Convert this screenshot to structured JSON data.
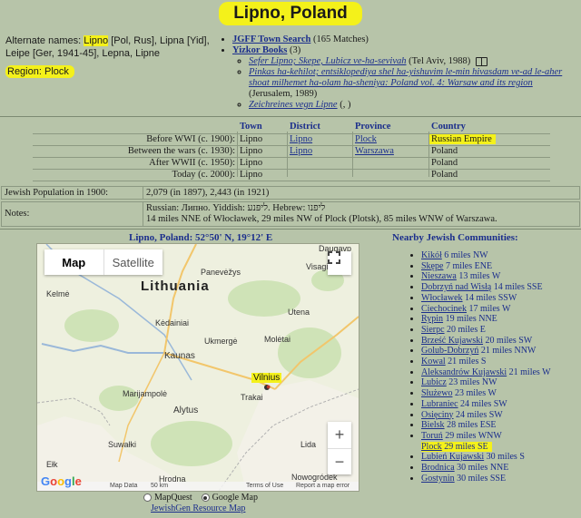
{
  "title": "Lipno, Poland",
  "header": {
    "alternate_names_label": "Alternate names:",
    "alternate_names_rest": "[Pol, Rus], Lipna [Yid], Leipe [Ger, 1941-45], Lepna, Lipne",
    "alternate_primary": "Lipno",
    "region_label": "Region:",
    "region_value": "Plock"
  },
  "links": {
    "jgff_label": "JGFF Town Search",
    "jgff_count": "(165 Matches)",
    "yizkor_label": "Yizkor Books",
    "yizkor_count": "(3)",
    "books": [
      {
        "title": "Sefer Lipno; Skepe, Lubicz ve-ha-sevivah",
        "note": "(Tel Aviv, 1988)"
      },
      {
        "title": "Pinkas ha-kehilot; entsiklopediya shel ha-yishuvim le-min hivasdam ve-ad le-aher shoat milhemet ha-olam ha-sheniya: Poland vol. 4: Warsaw and its region",
        "note": "(Jerusalem, 1989)"
      },
      {
        "title": "Zeichreines vegn Lipne",
        "note": "(, )"
      }
    ]
  },
  "jurisdiction": {
    "headers": [
      "Town",
      "District",
      "Province",
      "Country"
    ],
    "rows": [
      {
        "period": "Before WWI (c. 1900):",
        "town": "Lipno",
        "district": "Lipno",
        "province": "Plock",
        "country": "Russian Empire"
      },
      {
        "period": "Between the wars (c. 1930):",
        "town": "Lipno",
        "district": "Lipno",
        "province": "Warszawa",
        "country": "Poland"
      },
      {
        "period": "After WWII (c. 1950):",
        "town": "Lipno",
        "district": "",
        "province": "",
        "country": "Poland"
      },
      {
        "period": "Today (c. 2000):",
        "town": "Lipno",
        "district": "",
        "province": "",
        "country": "Poland"
      }
    ]
  },
  "population": {
    "label": "Jewish Population in 1900:",
    "value": "2,079 (in 1897), 2,443 (in 1921)"
  },
  "notes": {
    "label": "Notes:",
    "line1": "Russian: Липно. Yiddish: ליפּנע. Hebrew: ליפנו",
    "line2": "14 miles NNE of Włocławek, 29 miles NW of Plock (Plotsk), 85 miles WNW of Warszawa."
  },
  "map": {
    "caption": "Lipno, Poland: 52°50' N, 19°12' E",
    "btn_map": "Map",
    "btn_satellite": "Satellite",
    "country_label": "Lithuania",
    "city_labels": [
      "Daugavp",
      "Panevėžys",
      "Kėdainiai",
      "Ukmergė",
      "Kaunas",
      "Vilnius",
      "Alytus",
      "Marijampolė",
      "Trakai",
      "Suwałki",
      "Hrodna",
      "Ełk",
      "Kelmė",
      "Utena",
      "Visaginas",
      "Molėtai",
      "Lida",
      "Nowogródek"
    ],
    "footer_data": "Map Data",
    "footer_scale": "50 km",
    "footer_terms": "Terms of Use",
    "footer_report": "Report a map error",
    "zoom_in": "+",
    "zoom_out": "−",
    "opt_mapquest": "MapQuest",
    "opt_google": "Google Map",
    "resource_link": "JewishGen Resource Map"
  },
  "nearby": {
    "title": "Nearby Jewish Communities:",
    "items": [
      {
        "name": "Kikół",
        "dist": "6 miles NW"
      },
      {
        "name": "Skępe",
        "dist": "7 miles ENE"
      },
      {
        "name": "Nieszawa",
        "dist": "13 miles W"
      },
      {
        "name": "Dobrzyń nad Wisłą",
        "dist": "14 miles SSE"
      },
      {
        "name": "Włocławek",
        "dist": "14 miles SSW"
      },
      {
        "name": "Ciechocinek",
        "dist": "17 miles W"
      },
      {
        "name": "Rypin",
        "dist": "19 miles NNE"
      },
      {
        "name": "Sierpc",
        "dist": "20 miles E"
      },
      {
        "name": "Brześć Kujawski",
        "dist": "20 miles SW"
      },
      {
        "name": "Golub-Dobrzyń",
        "dist": "21 miles NNW"
      },
      {
        "name": "Kowal",
        "dist": "21 miles S"
      },
      {
        "name": "Aleksandrów Kujawski",
        "dist": "21 miles W"
      },
      {
        "name": "Lubicz",
        "dist": "23 miles NW"
      },
      {
        "name": "Służewo",
        "dist": "23 miles W"
      },
      {
        "name": "Lubraniec",
        "dist": "24 miles SW"
      },
      {
        "name": "Osięciny",
        "dist": "24 miles SW"
      },
      {
        "name": "Bielsk",
        "dist": "28 miles ESE"
      },
      {
        "name": "Toruń",
        "dist": "29 miles WNW"
      },
      {
        "name": "Plock",
        "dist": "29 miles SE"
      },
      {
        "name": "Lubień Kujawski",
        "dist": "30 miles S"
      },
      {
        "name": "Brodnica",
        "dist": "30 miles NNE"
      },
      {
        "name": "Gostynin",
        "dist": "30 miles SSE"
      }
    ]
  },
  "colors": {
    "background": "#b7c4a9",
    "highlight": "#f4f11a",
    "link": "#1b2e8c"
  }
}
